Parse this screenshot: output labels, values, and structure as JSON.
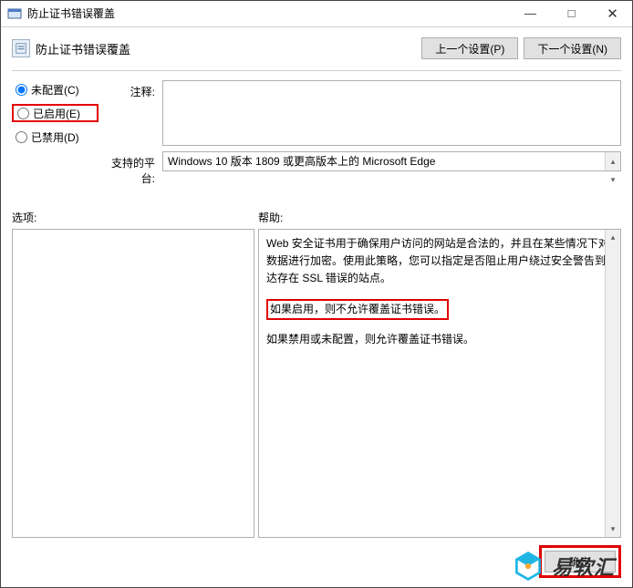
{
  "window": {
    "title": "防止证书错误覆盖",
    "minimize": "—",
    "maximize": "□",
    "close": "✕"
  },
  "header": {
    "title": "防止证书错误覆盖",
    "prev_btn": "上一个设置(P)",
    "next_btn": "下一个设置(N)"
  },
  "radios": {
    "not_configured": "未配置(C)",
    "enabled": "已启用(E)",
    "disabled": "已禁用(D)"
  },
  "fields": {
    "comment_label": "注释:",
    "comment_value": "",
    "platform_label": "支持的平台:",
    "platform_value": "Windows 10 版本 1809 或更高版本上的 Microsoft Edge"
  },
  "sections": {
    "options_label": "选项:",
    "help_label": "帮助:"
  },
  "help": {
    "p1": "Web 安全证书用于确保用户访问的网站是合法的，并且在某些情况下对数据进行加密。使用此策略，您可以指定是否阻止用户绕过安全警告到达存在 SSL 错误的站点。",
    "p2": "如果启用，则不允许覆盖证书错误。",
    "p3": "如果禁用或未配置，则允许覆盖证书错误。"
  },
  "footer": {
    "ok": "确定"
  },
  "watermark": {
    "text": "易软汇"
  }
}
